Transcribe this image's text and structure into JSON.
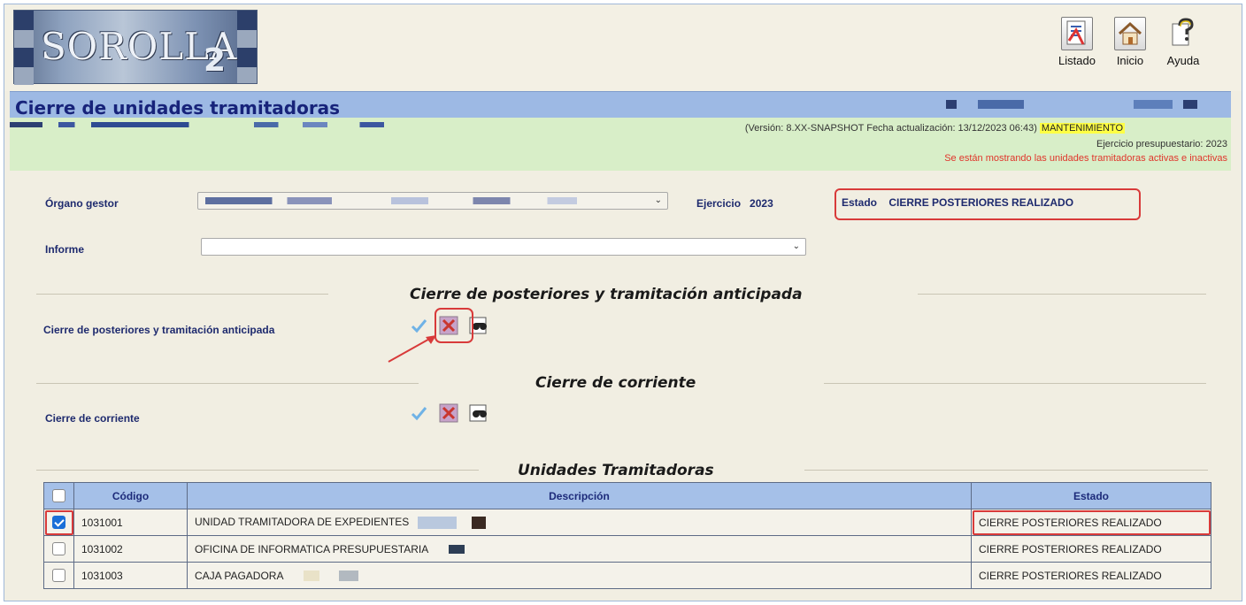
{
  "app": {
    "logo_text": "SOROLLA",
    "logo_suffix": "2"
  },
  "toolbar": {
    "items": [
      {
        "label": "Listado",
        "icon": "report-list-icon"
      },
      {
        "label": "Inicio",
        "icon": "home-icon"
      },
      {
        "label": "Ayuda",
        "icon": "help-icon"
      }
    ]
  },
  "page": {
    "title": "Cierre de unidades tramitadoras",
    "version_text": "(Versión: 8.XX-SNAPSHOT Fecha actualización: 13/12/2023 06:43)",
    "mode_badge": "MANTENIMIENTO",
    "ejercicio_presupuestario": "Ejercicio presupuestario: 2023",
    "warning": "Se están mostrando las unidades tramitadoras activas e inactivas"
  },
  "form": {
    "organo_gestor_label": "Órgano gestor",
    "organo_gestor_value": "",
    "ejercicio_label": "Ejercicio",
    "ejercicio_value": "2023",
    "estado_label": "Estado",
    "estado_value": "CIERRE POSTERIORES REALIZADO",
    "informe_label": "Informe",
    "informe_value": ""
  },
  "sections": {
    "posteriores": {
      "title": "Cierre de posteriores y tramitación anticipada",
      "row_label": "Cierre de posteriores y tramitación anticipada",
      "icons": [
        "check-close-icon",
        "undo-close-icon",
        "search-binoculars-icon"
      ]
    },
    "corriente": {
      "title": "Cierre de corriente",
      "row_label": "Cierre de corriente",
      "icons": [
        "check-close-icon",
        "undo-close-icon",
        "search-binoculars-icon"
      ]
    },
    "unidades": {
      "title": "Unidades Tramitadoras"
    }
  },
  "table": {
    "columns": [
      "",
      "Código",
      "Descripción",
      "Estado"
    ],
    "rows": [
      {
        "checked": true,
        "codigo": "1031001",
        "descripcion": "UNIDAD TRAMITADORA DE EXPEDIENTES",
        "estado": "CIERRE POSTERIORES REALIZADO"
      },
      {
        "checked": false,
        "codigo": "1031002",
        "descripcion": "OFICINA DE INFORMATICA PRESUPUESTARIA",
        "estado": "CIERRE POSTERIORES REALIZADO"
      },
      {
        "checked": false,
        "codigo": "1031003",
        "descripcion": "CAJA PAGADORA",
        "estado": "CIERRE POSTERIORES REALIZADO"
      }
    ]
  },
  "colors": {
    "title_bar": "#9db9e4",
    "version_bar": "#d8eec8",
    "highlight_red": "#d83a3a",
    "table_header": "#a5c0e8"
  }
}
